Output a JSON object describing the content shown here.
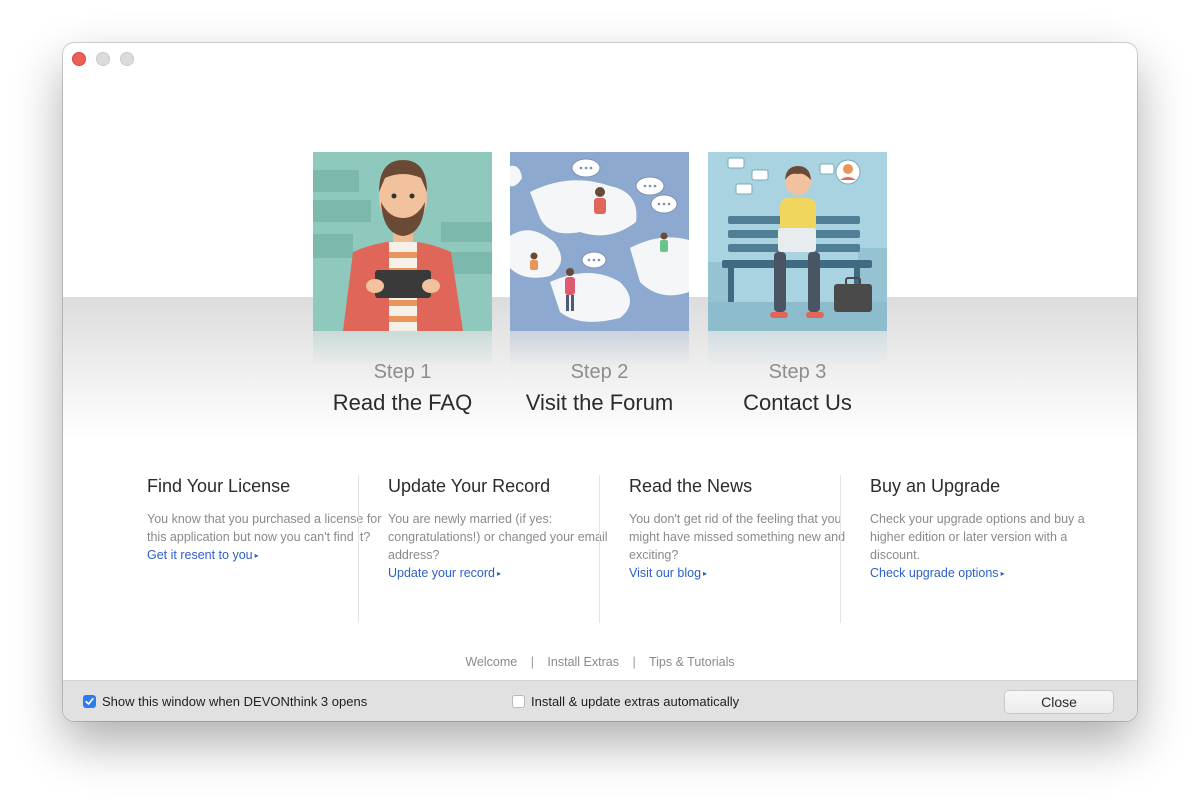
{
  "steps": [
    {
      "num": "Step 1",
      "title": "Read the FAQ"
    },
    {
      "num": "Step 2",
      "title": "Visit the Forum"
    },
    {
      "num": "Step 3",
      "title": "Contact Us"
    }
  ],
  "info": [
    {
      "title": "Find Your License",
      "text": "You know that you purchased a license for this application but now you can't find it?",
      "link": "Get it resent to you"
    },
    {
      "title": "Update Your Record",
      "text": "You are newly married (if yes: congratulations!) or changed your email address?",
      "link": "Update your record"
    },
    {
      "title": "Read the News",
      "text": "You don't get rid of the feeling that you might have missed something new and exciting?",
      "link": "Visit our blog"
    },
    {
      "title": "Buy an Upgrade",
      "text": "Check your upgrade options and buy a higher edition or later version with a discount.",
      "link": "Check upgrade options"
    }
  ],
  "nav_links": [
    "Welcome",
    "Install Extras",
    "Tips & Tutorials"
  ],
  "footer": {
    "show_window_label": "Show this window when DEVONthink 3 opens",
    "show_window_checked": true,
    "install_extras_label": "Install & update extras automatically",
    "install_extras_checked": false,
    "close_label": "Close"
  },
  "colors": {
    "link": "#2d5fc5",
    "checkbox_on": "#2b7cf0",
    "close_light": "#ee5f57"
  },
  "icons": [
    "close-light",
    "minimize-light",
    "zoom-light",
    "link-arrow-icon",
    "checkbox-checked-icon",
    "checkbox-unchecked-icon"
  ]
}
